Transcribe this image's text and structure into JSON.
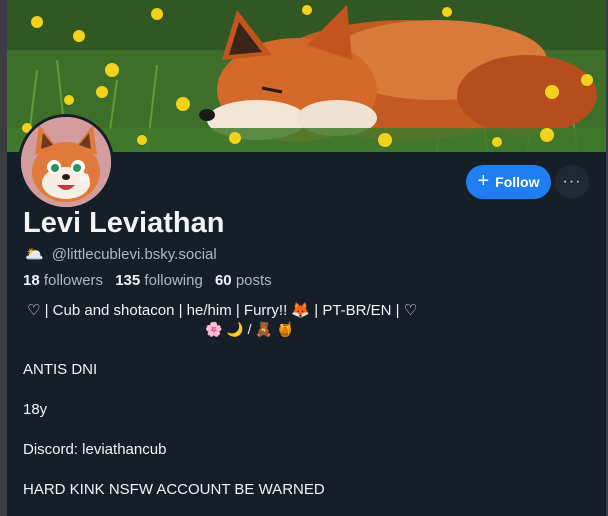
{
  "profile": {
    "display_name": "Levi Leviathan",
    "handle_emoji": "🌥️",
    "handle": "@littlecublevi.bsky.social",
    "followers_count": "18",
    "followers_label": "followers",
    "following_count": "135",
    "following_label": "following",
    "posts_count": "60",
    "posts_label": "posts"
  },
  "actions": {
    "follow_label": "Follow",
    "more_label": "···"
  },
  "bio": {
    "line1": "♡ | Cub and shotacon | he/him | Furry!! 🦊 | PT-BR/EN | ♡",
    "line2": "🌸 🌙 / 🧸 🍯",
    "antis": "ANTIS DNI",
    "age": "18y",
    "discord": "Discord: leviathancub",
    "warning": "HARD KINK NSFW ACCOUNT BE WARNED"
  }
}
